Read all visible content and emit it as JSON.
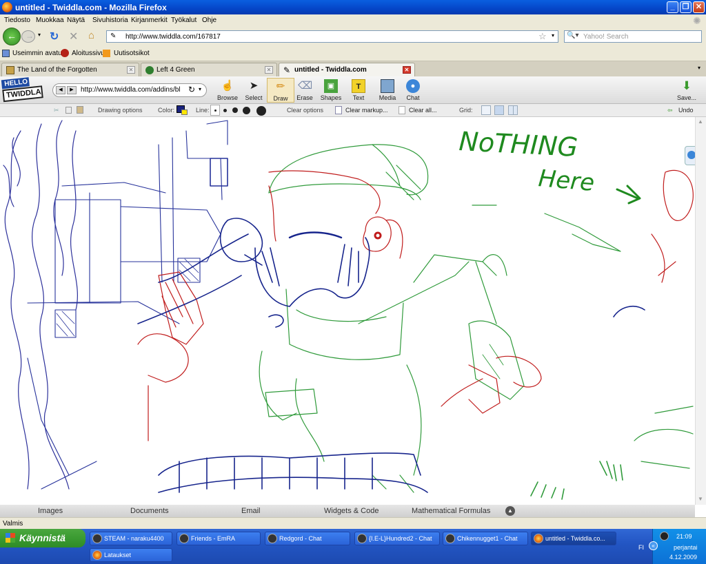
{
  "window": {
    "title": "untitled - Twiddla.com - Mozilla Firefox"
  },
  "menu": [
    "Tiedosto",
    "Muokkaa",
    "Näytä",
    "Sivuhistoria",
    "Kirjanmerkit",
    "Työkalut",
    "Ohje"
  ],
  "nav": {
    "url": "http://www.twiddla.com/167817",
    "search_placeholder": "Yahoo! Search"
  },
  "bookmarks": [
    "Useimmin avatut",
    "Aloitussivu",
    "Uutisotsikot"
  ],
  "tabs": [
    {
      "label": "The Land of the Forgotten",
      "active": false
    },
    {
      "label": "Left 4 Green",
      "active": false
    },
    {
      "label": "untitled - Twiddla.com",
      "active": true
    }
  ],
  "twiddla": {
    "logo_top": "HELLO",
    "logo_bottom": "TWIDDLA",
    "inner_url": "http://www.twiddla.com/addins/bl",
    "tools": [
      "Browse",
      "Select",
      "Draw",
      "Erase",
      "Shapes",
      "Text",
      "Media",
      "Chat"
    ],
    "save_label": "Save...",
    "options": {
      "drawing": "Drawing options",
      "color": "Color:",
      "line": "Line:",
      "clear": "Clear options",
      "clear_markup": "Clear markup...",
      "clear_all": "Clear all...",
      "grid": "Grid:",
      "undo": "Undo"
    },
    "colors": {
      "current": "#1a237e"
    }
  },
  "canvas": {
    "text1": "NoTHING",
    "text2": "Here"
  },
  "widgets": [
    "Images",
    "Documents",
    "Email",
    "Widgets & Code",
    "Mathematical Formulas"
  ],
  "status": "Valmis",
  "taskbar": {
    "start": "Käynnistä",
    "items_row1": [
      "STEAM - naraku4400",
      "Friends - EmRA",
      "Redgord - Chat",
      "{I.E-L}Hundred2 - Chat",
      "Chikennugget1 - Chat",
      "untitled - Twiddla.co..."
    ],
    "items_row2": [
      "Lataukset"
    ],
    "tray": {
      "lang": "FI",
      "time": "21:09",
      "day": "perjantai",
      "date": "4.12.2009"
    }
  }
}
